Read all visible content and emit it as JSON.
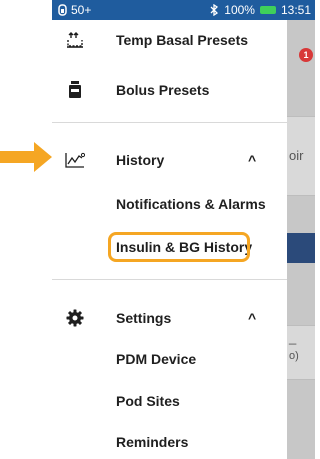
{
  "status_bar": {
    "signal": "50+",
    "battery_pct": "100%",
    "time": "13:51"
  },
  "scrim": {
    "partial_text_1": "oir",
    "partial_text_2": "o)",
    "partial_text_3": "_",
    "badge": "1"
  },
  "menu": {
    "temp_basal": "Temp Basal Presets",
    "bolus": "Bolus Presets",
    "history": "History",
    "history_chevron": "^",
    "notifications": "Notifications & Alarms",
    "insulin_bg": "Insulin & BG History",
    "settings": "Settings",
    "settings_chevron": "^",
    "pdm_device": "PDM Device",
    "pod_sites": "Pod Sites",
    "reminders": "Reminders"
  },
  "colors": {
    "status_bar": "#1f5c9e",
    "highlight": "#f5a623",
    "arrow": "#f5a623"
  }
}
